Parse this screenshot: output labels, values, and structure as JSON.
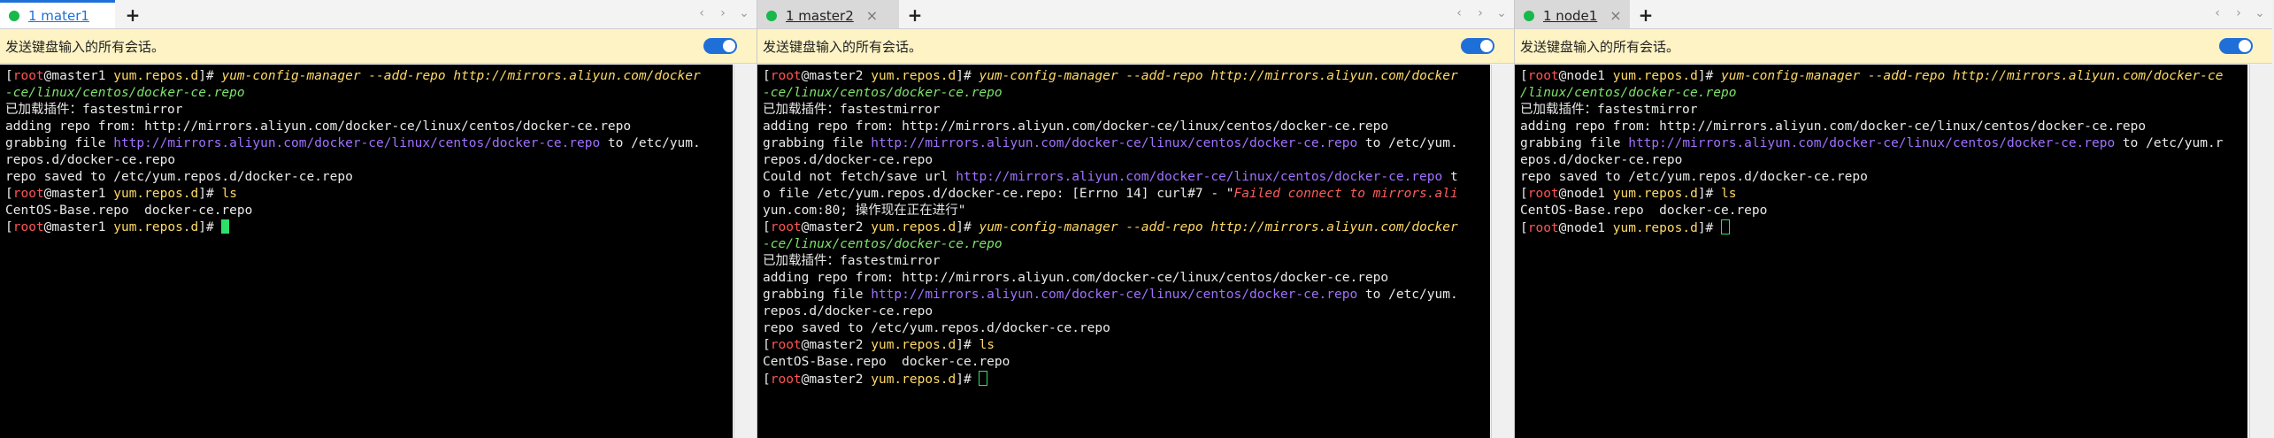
{
  "colors": {
    "accent": "#1f6fd8",
    "notice_bg": "#fdf3c4",
    "status_dot": "#18b84a",
    "terminal_bg": "#000000",
    "cursor": "#2ee06a"
  },
  "icons": {
    "tab_status": "green-dot-icon",
    "add": "plus-icon",
    "prev": "chevron-left-icon",
    "next": "chevron-right-icon",
    "menu": "chevron-down-icon",
    "toggle": "toggle-icon",
    "close": "close-icon"
  },
  "panes": [
    {
      "tab_label": "1 mater1",
      "add_tab": "+",
      "notice": "发送键盘输入的所有会话。",
      "term": {
        "l1_root": "root",
        "l1_host": "master1",
        "l1_path": "yum.repos.d",
        "l1_cmd": "yum-config-manager --add-repo http://mirrors.aliyun.com/docker",
        "l2": "-ce/linux/centos/docker-ce.repo",
        "l3": "已加载插件：fastestmirror",
        "l4": "adding repo from: http://mirrors.aliyun.com/docker-ce/linux/centos/docker-ce.repo",
        "l5_a": "grabbing file ",
        "l5_url": "http://mirrors.aliyun.com/docker-ce/linux/centos/docker-ce.repo",
        "l5_b": " to /etc/yum.",
        "l6": "repos.d/docker-ce.repo",
        "l7": "repo saved to /etc/yum.repos.d/docker-ce.repo",
        "l8_cmd": "ls",
        "l9": "CentOS-Base.repo  docker-ce.repo"
      }
    },
    {
      "tab_label": "1 master2",
      "add_tab": "+",
      "close": "×",
      "notice": "发送键盘输入的所有会话。",
      "term": {
        "l1_root": "root",
        "l1_host": "master2",
        "l1_path": "yum.repos.d",
        "l1_cmd": "yum-config-manager --add-repo http://mirrors.aliyun.com/docker",
        "l2": "-ce/linux/centos/docker-ce.repo",
        "l3": "已加载插件：fastestmirror",
        "l4": "adding repo from: http://mirrors.aliyun.com/docker-ce/linux/centos/docker-ce.repo",
        "l5_a": "grabbing file ",
        "l5_url": "http://mirrors.aliyun.com/docker-ce/linux/centos/docker-ce.repo",
        "l5_b": " to /etc/yum.",
        "l6": "repos.d/docker-ce.repo",
        "l7_a": "Could not fetch/save url ",
        "l7_url": "http://mirrors.aliyun.com/docker-ce/linux/centos/docker-ce.repo",
        "l7_b": " t",
        "l8_a": "o file /etc/yum.repos.d/docker-ce.repo: [Errno 14] curl#7 - \"",
        "l8_err": "Failed connect to mirrors.ali",
        "l9": "yun.com:80; 操作现在正在进行\"",
        "l10_cmd": "yum-config-manager --add-repo http://mirrors.aliyun.com/docker",
        "l11": "-ce/linux/centos/docker-ce.repo",
        "l12": "已加载插件：fastestmirror",
        "l13": "adding repo from: http://mirrors.aliyun.com/docker-ce/linux/centos/docker-ce.repo",
        "l14_a": "grabbing file ",
        "l14_url": "http://mirrors.aliyun.com/docker-ce/linux/centos/docker-ce.repo",
        "l14_b": " to /etc/yum.",
        "l15": "repos.d/docker-ce.repo",
        "l16": "repo saved to /etc/yum.repos.d/docker-ce.repo",
        "l17_cmd": "ls",
        "l18": "CentOS-Base.repo  docker-ce.repo"
      }
    },
    {
      "tab_label": "1 node1",
      "add_tab": "+",
      "close": "×",
      "notice": "发送键盘输入的所有会话。",
      "term": {
        "l1_root": "root",
        "l1_host": "node1",
        "l1_path": "yum.repos.d",
        "l1_cmd": "yum-config-manager --add-repo http://mirrors.aliyun.com/docker-ce",
        "l2": "/linux/centos/docker-ce.repo",
        "l3": "已加载插件：fastestmirror",
        "l4": "adding repo from: http://mirrors.aliyun.com/docker-ce/linux/centos/docker-ce.repo",
        "l5_a": "grabbing file ",
        "l5_url": "http://mirrors.aliyun.com/docker-ce/linux/centos/docker-ce.repo",
        "l5_b": " to /etc/yum.r",
        "l6": "epos.d/docker-ce.repo",
        "l7": "repo saved to /etc/yum.repos.d/docker-ce.repo",
        "l8_cmd": "ls",
        "l9": "CentOS-Base.repo  docker-ce.repo"
      }
    }
  ]
}
